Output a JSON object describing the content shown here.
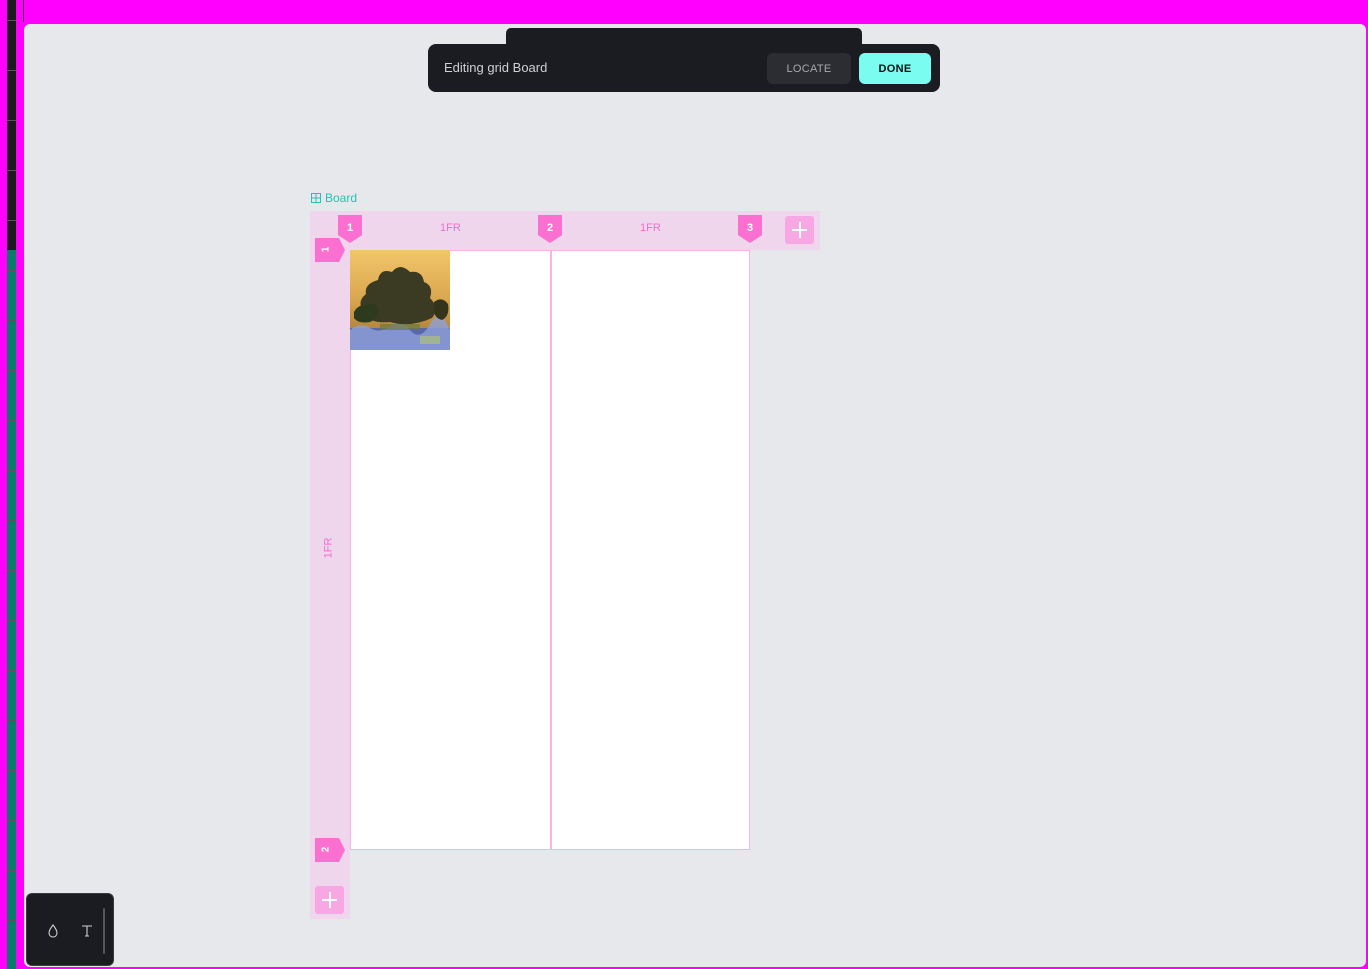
{
  "editor": {
    "status_text": "Editing grid Board",
    "locate_label": "LOCATE",
    "done_label": "DONE"
  },
  "board": {
    "name": "Board",
    "columns": [
      {
        "index": "1",
        "size": "1FR"
      },
      {
        "index": "2",
        "size": "1FR"
      },
      {
        "index": "3"
      }
    ],
    "rows": [
      {
        "index": "1",
        "size": "1FR"
      },
      {
        "index": "2"
      }
    ]
  },
  "colors": {
    "accent_magenta": "#fb6fd0",
    "done_button": "#7afcf0",
    "board_label": "#24c3b3",
    "canvas": "#e7e8eb"
  },
  "icons": {
    "board": "grid-icon",
    "drop": "drop-icon",
    "text": "text-tool-icon",
    "add": "plus-icon"
  }
}
